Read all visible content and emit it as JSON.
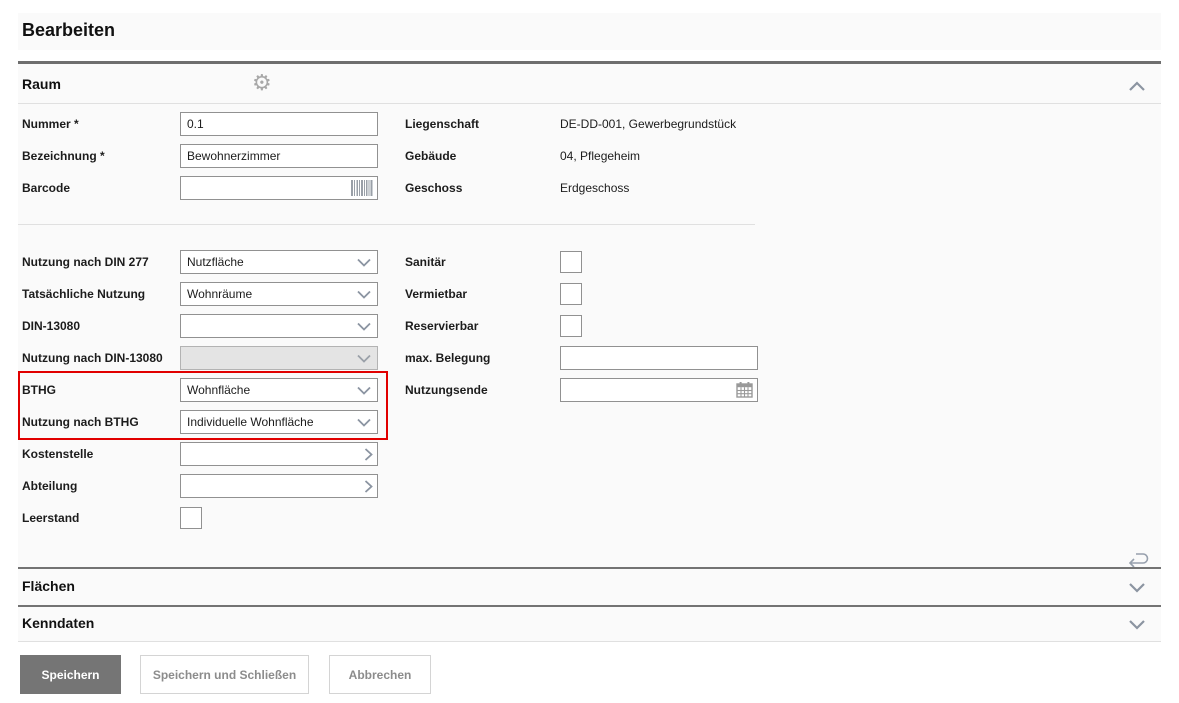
{
  "header": {
    "title": "Bearbeiten"
  },
  "icons": {
    "gear": "⚙"
  },
  "colors": {
    "highlight_red": "#e10000",
    "primary_button_bg": "#757575",
    "section_bg": "#fafafa"
  },
  "raum": {
    "title": "Raum",
    "left": {
      "nummer": {
        "label": "Nummer *",
        "value": "0.1"
      },
      "bezeichnung": {
        "label": "Bezeichnung *",
        "value": "Bewohnerzimmer"
      },
      "barcode": {
        "label": "Barcode",
        "value": ""
      },
      "nutzung_din277": {
        "label": "Nutzung nach DIN 277",
        "value": "Nutzfläche"
      },
      "tatsaechliche_nutzung": {
        "label": "Tatsächliche Nutzung",
        "value": "Wohnräume"
      },
      "din13080": {
        "label": "DIN-13080",
        "value": ""
      },
      "nutzung_din13080": {
        "label": "Nutzung nach DIN-13080",
        "value": "",
        "disabled": true
      },
      "bthg": {
        "label": "BTHG",
        "value": "Wohnfläche"
      },
      "nutzung_bthg": {
        "label": "Nutzung nach BTHG",
        "value": "Individuelle Wohnfläche"
      },
      "kostenstelle": {
        "label": "Kostenstelle",
        "value": ""
      },
      "abteilung": {
        "label": "Abteilung",
        "value": ""
      },
      "leerstand": {
        "label": "Leerstand",
        "checked": false
      }
    },
    "right": {
      "liegenschaft": {
        "label": "Liegenschaft",
        "value": "DE-DD-001, Gewerbegrundstück"
      },
      "gebaeude": {
        "label": "Gebäude",
        "value": "04, Pflegeheim"
      },
      "geschoss": {
        "label": "Geschoss",
        "value": "Erdgeschoss"
      },
      "sanitaer": {
        "label": "Sanitär",
        "checked": false
      },
      "vermietbar": {
        "label": "Vermietbar",
        "checked": false
      },
      "reservierbar": {
        "label": "Reservierbar",
        "checked": false
      },
      "max_belegung": {
        "label": "max. Belegung",
        "value": ""
      },
      "nutzungsende": {
        "label": "Nutzungsende",
        "value": ""
      }
    }
  },
  "flaechen": {
    "title": "Flächen"
  },
  "kenndaten": {
    "title": "Kenndaten"
  },
  "footer": {
    "save": "Speichern",
    "save_and_close": "Speichern und Schließen",
    "cancel": "Abbrechen"
  }
}
